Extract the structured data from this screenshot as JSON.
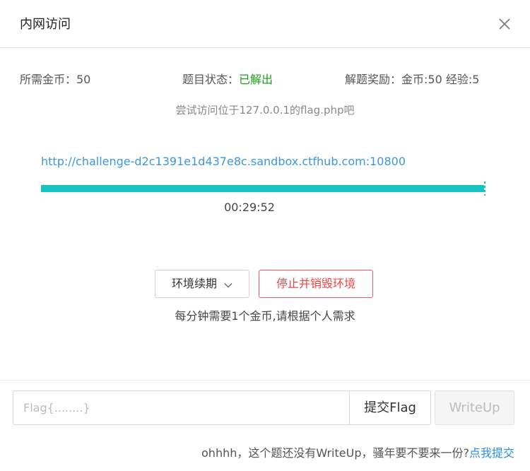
{
  "modal": {
    "title": "内网访问"
  },
  "stats": {
    "coins_required": "所需金币：50",
    "status_label": "题目状态：",
    "status_value": "已解出",
    "reward": "解题奖励：金币:50 经验:5"
  },
  "hint": "尝试访问位于127.0.0.1的flag.php吧",
  "environment": {
    "url": "http://challenge-d2c1391e1d437e8c.sandbox.ctfhub.com:10800",
    "progress_fraction": 1.0,
    "remaining_time": "00:29:52"
  },
  "actions": {
    "renew_label": "环境续期",
    "destroy_label": "停止并销毁环境",
    "notice": "每分钟需要1个金币,请根据个人需求"
  },
  "flag": {
    "placeholder": "Flag{........}",
    "value": "",
    "submit_label": "提交Flag",
    "writeup_label": "WriteUp"
  },
  "footer": {
    "note": "ohhhh，这个题还没有WriteUp，骚年要不要来一份?",
    "link_label": "点我提交"
  },
  "colors": {
    "accent_teal": "#17c2c2",
    "link_blue": "#3a97e0",
    "solved_green": "#19a019",
    "danger_red": "#f04444"
  }
}
